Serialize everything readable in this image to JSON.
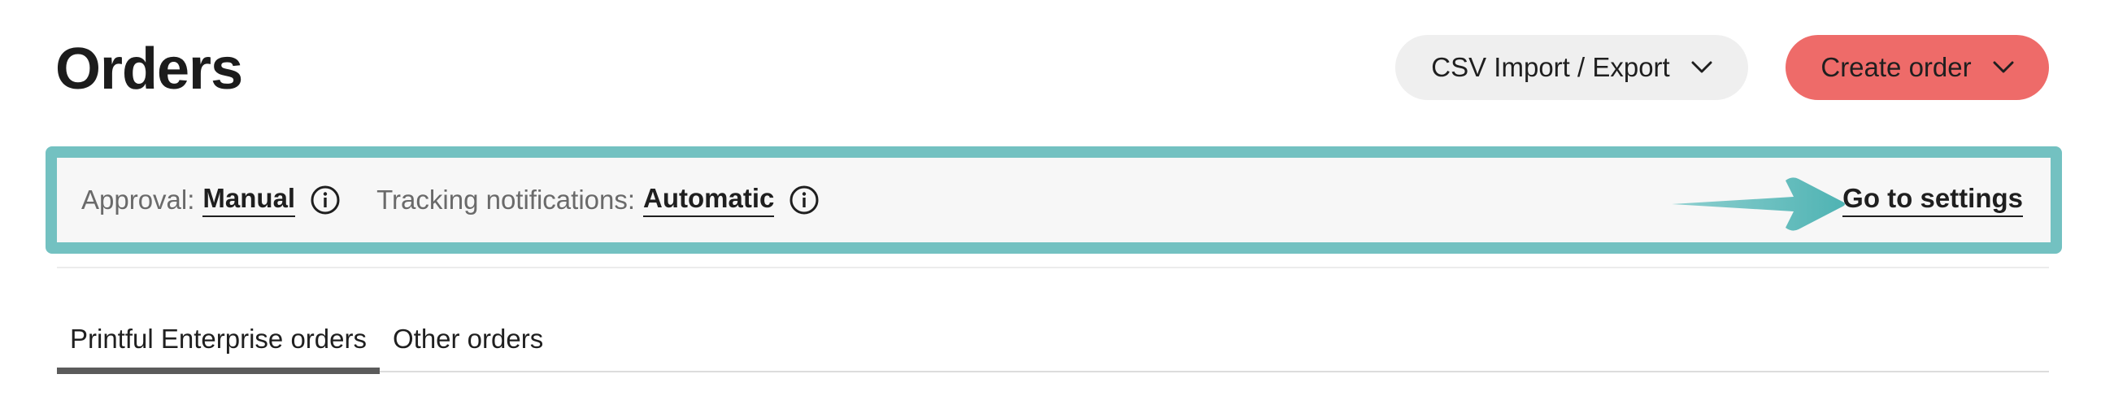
{
  "page": {
    "title": "Orders"
  },
  "header": {
    "csv_button": {
      "label": "CSV Import / Export",
      "icon": "chevron-down-icon"
    },
    "create_button": {
      "label": "Create order",
      "icon": "chevron-down-icon"
    }
  },
  "settings_bar": {
    "approval": {
      "label": "Approval:",
      "value": "Manual",
      "icon": "info-icon"
    },
    "tracking": {
      "label": "Tracking notifications:",
      "value": "Automatic",
      "icon": "info-icon"
    },
    "link": "Go to settings"
  },
  "tabs": [
    {
      "label": "Printful Enterprise orders",
      "active": true
    },
    {
      "label": "Other orders",
      "active": false
    }
  ],
  "colors": {
    "accent_red": "#ee6b69",
    "highlight_teal": "#73c1c1",
    "neutral_button": "#efefef"
  }
}
